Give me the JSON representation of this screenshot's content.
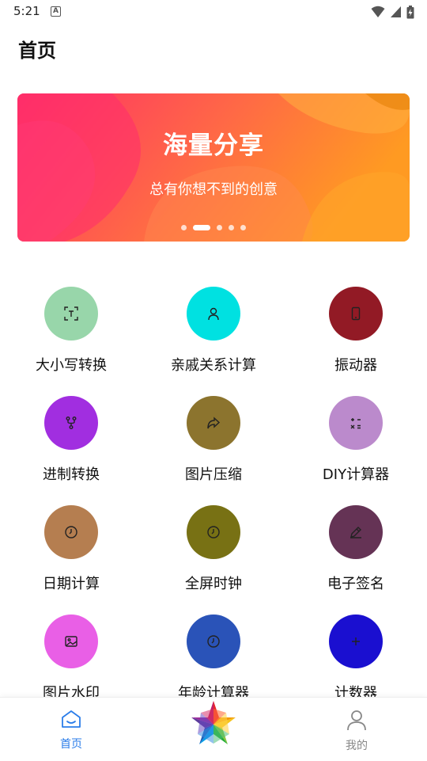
{
  "status": {
    "time": "5:21",
    "notification_letter": "A"
  },
  "page": {
    "title": "首页"
  },
  "banner": {
    "title": "海量分享",
    "subtitle": "总有你想不到的创意",
    "slide_count": 5,
    "active_slide": 2
  },
  "tools": [
    {
      "label": "大小写转换",
      "icon": "text-scan-icon",
      "color": "#98d6aa"
    },
    {
      "label": "亲戚关系计算",
      "icon": "person-icon",
      "color": "#00e1e1"
    },
    {
      "label": "振动器",
      "icon": "phone-icon",
      "color": "#921a25"
    },
    {
      "label": "进制转换",
      "icon": "fork-icon",
      "color": "#a12ee0"
    },
    {
      "label": "图片压缩",
      "icon": "share-arrow-icon",
      "color": "#8c742e"
    },
    {
      "label": "DIY计算器",
      "icon": "calculator-icon",
      "color": "#bb8acc"
    },
    {
      "label": "日期计算",
      "icon": "clock-icon",
      "color": "#b57e50"
    },
    {
      "label": "全屏时钟",
      "icon": "clock-icon",
      "color": "#787114"
    },
    {
      "label": "电子签名",
      "icon": "pen-icon",
      "color": "#653355"
    },
    {
      "label": "图片水印",
      "icon": "image-icon",
      "color": "#e95fe6"
    },
    {
      "label": "年龄计算器",
      "icon": "clock-icon",
      "color": "#2a53b8"
    },
    {
      "label": "计数器",
      "icon": "plus-icon",
      "color": "#1a0fd0"
    }
  ],
  "nav": {
    "home_label": "首页",
    "mine_label": "我的",
    "active_color": "#2b7de9",
    "inactive_color": "#888888"
  }
}
